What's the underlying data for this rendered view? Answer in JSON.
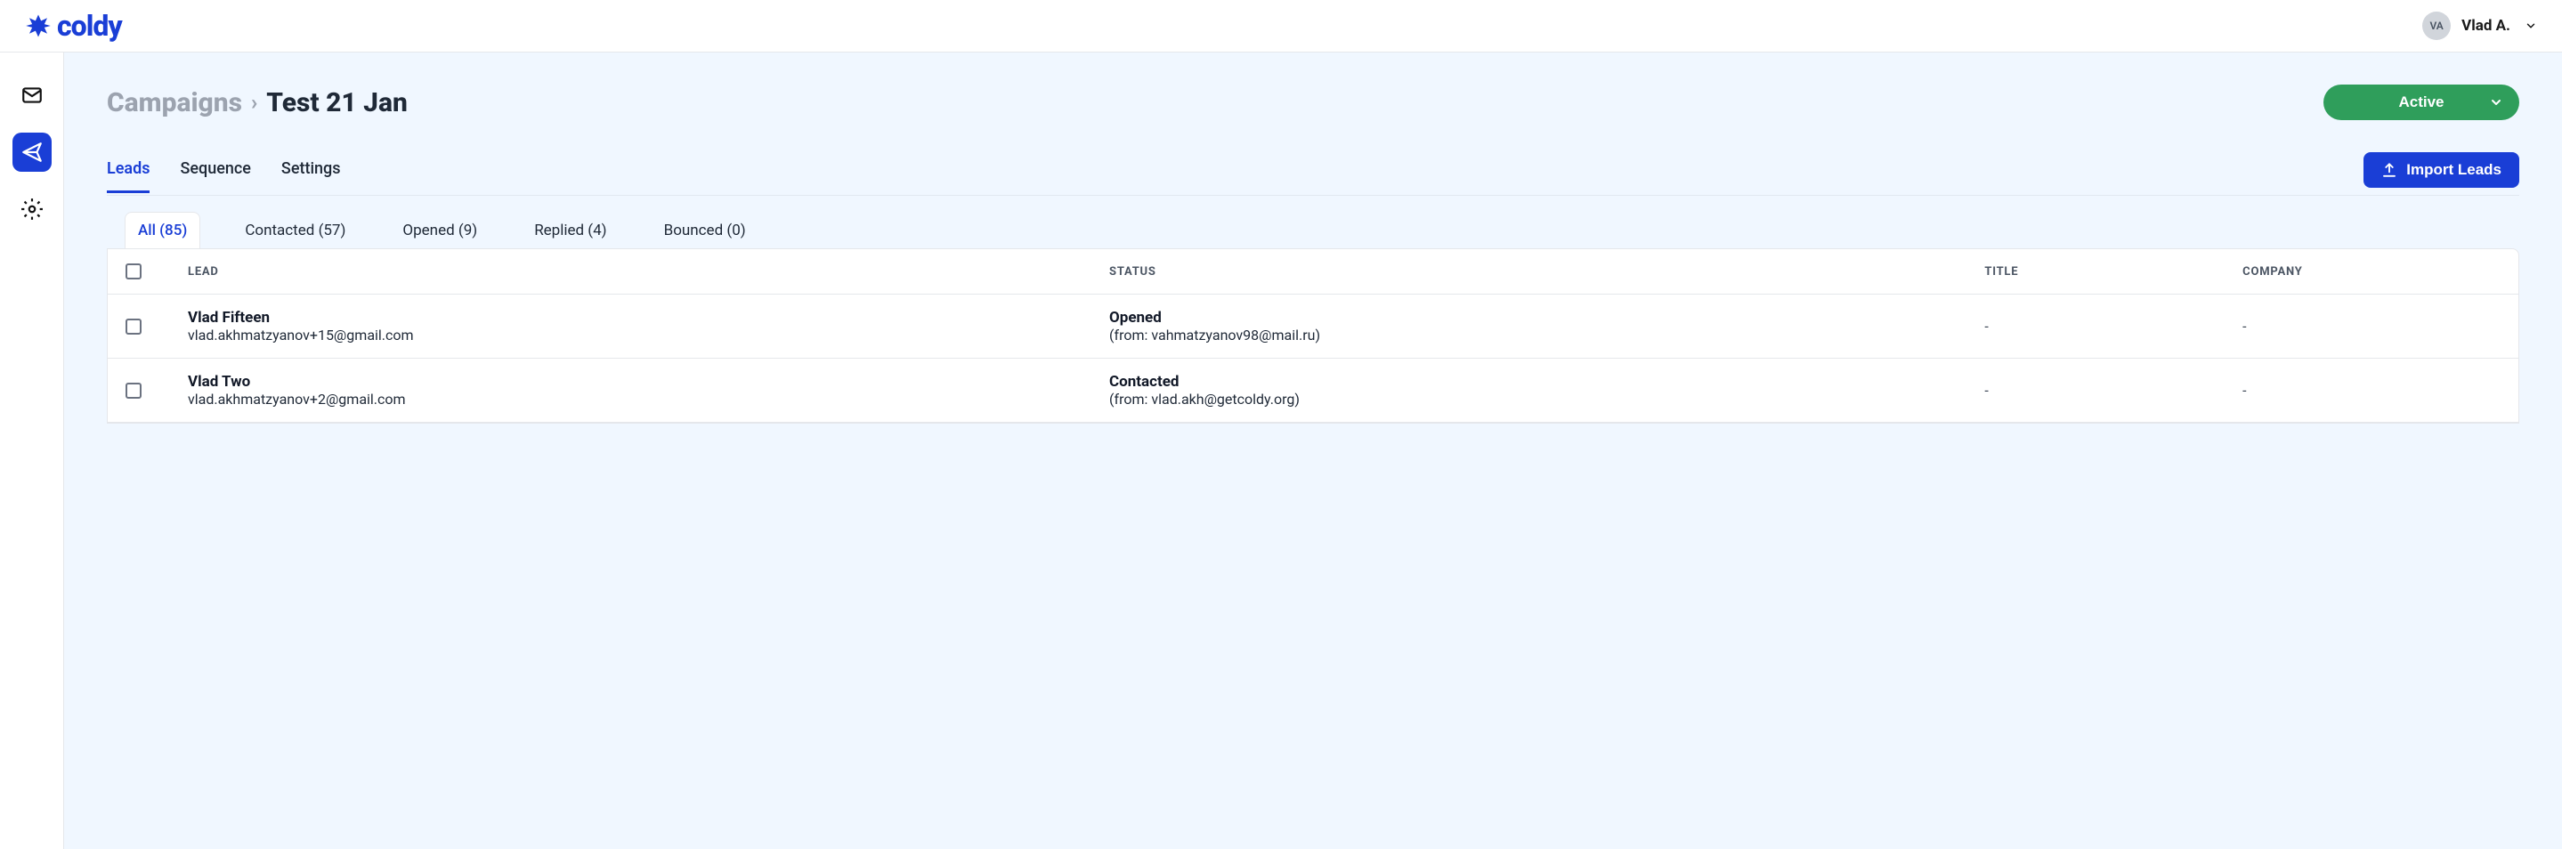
{
  "header": {
    "brand": "coldy",
    "user_initials": "VA",
    "user_name": "Vlad A."
  },
  "sidebar": {
    "items": [
      {
        "name": "mail",
        "active": false
      },
      {
        "name": "send",
        "active": true
      },
      {
        "name": "settings",
        "active": false
      }
    ]
  },
  "breadcrumb": {
    "parent": "Campaigns",
    "current": "Test 21 Jan"
  },
  "status_button": {
    "label": "Active"
  },
  "tabs": [
    {
      "label": "Leads",
      "active": true
    },
    {
      "label": "Sequence",
      "active": false
    },
    {
      "label": "Settings",
      "active": false
    }
  ],
  "import_button": "Import Leads",
  "filter_tabs": [
    {
      "label": "All (85)",
      "active": true
    },
    {
      "label": "Contacted (57)",
      "active": false
    },
    {
      "label": "Opened (9)",
      "active": false
    },
    {
      "label": "Replied (4)",
      "active": false
    },
    {
      "label": "Bounced (0)",
      "active": false
    }
  ],
  "table": {
    "headers": {
      "lead": "LEAD",
      "status": "STATUS",
      "title": "TITLE",
      "company": "COMPANY"
    },
    "rows": [
      {
        "name": "Vlad Fifteen",
        "email": "vlad.akhmatzyanov+15@gmail.com",
        "status": "Opened",
        "from": "(from: vahmatzyanov98@mail.ru)",
        "title": "-",
        "company": "-"
      },
      {
        "name": "Vlad Two",
        "email": "vlad.akhmatzyanov+2@gmail.com",
        "status": "Contacted",
        "from": "(from: vlad.akh@getcoldy.org)",
        "title": "-",
        "company": "-"
      }
    ]
  }
}
